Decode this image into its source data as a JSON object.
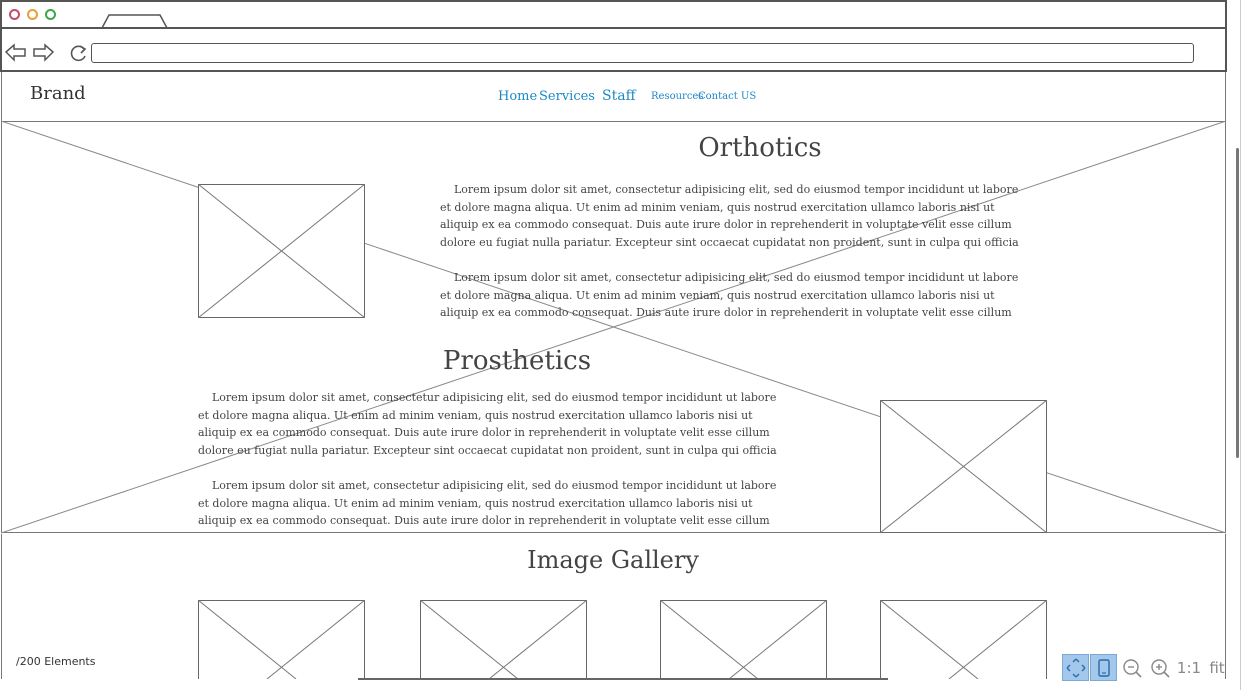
{
  "site": {
    "brand": "Brand",
    "nav": [
      "Home",
      "Services",
      "Staff",
      "Resources",
      "Contact US"
    ]
  },
  "sections": {
    "orthotics": {
      "title": "Orthotics",
      "paragraphs": [
        "Lorem ipsum dolor sit amet, consectetur adipisicing elit, sed do eiusmod tempor incididunt ut labore et dolore magna aliqua. Ut enim ad minim veniam, quis nostrud exercitation ullamco laboris nisi ut aliquip ex ea commodo consequat. Duis aute irure dolor in reprehenderit in voluptate velit esse cillum dolore eu fugiat nulla pariatur. Excepteur sint occaecat cupidatat non proident, sunt in culpa qui officia deserunt mollit anim id est laborum.",
        "Lorem ipsum dolor sit amet, consectetur adipisicing elit, sed do eiusmod tempor incididunt ut labore et dolore magna aliqua. Ut enim ad minim veniam, quis nostrud exercitation ullamco laboris nisi ut aliquip ex ea commodo consequat. Duis aute irure dolor in reprehenderit in voluptate velit esse cillum dolore eu fugiat nulla pariatur. Excepteur sint occaecat cupidatat non proident, sunt in"
      ]
    },
    "prosthetics": {
      "title": "Prosthetics",
      "paragraphs": [
        "Lorem ipsum dolor sit amet, consectetur adipisicing elit, sed do eiusmod tempor incididunt ut labore et dolore magna aliqua. Ut enim ad minim veniam, quis nostrud exercitation ullamco laboris nisi ut aliquip ex ea commodo consequat. Duis aute irure dolor in reprehenderit in voluptate velit esse cillum dolore eu fugiat nulla pariatur. Excepteur sint occaecat cupidatat non proident, sunt in culpa qui officia deserunt mollit anim id est laborum.",
        "Lorem ipsum dolor sit amet, consectetur adipisicing elit, sed do eiusmod tempor incididunt ut labore et dolore magna aliqua. Ut enim ad minim veniam, quis nostrud exercitation ullamco laboris nisi ut aliquip ex ea commodo consequat. Duis aute irure dolor in reprehenderit in voluptate velit esse cillum dolore eu fugiat nulla pariatur. Excepteur sint occaecat cupidatat non proident, sunt in"
      ]
    },
    "gallery": {
      "title": "Image Gallery"
    }
  },
  "status": {
    "elements": "/200 Elements"
  },
  "zoom": {
    "one_to_one": "1:1",
    "fit": "fit"
  },
  "colors": {
    "nav": "#1e88c7",
    "active_toggle": "#a3c8ec",
    "outline": "#555555"
  },
  "icons": [
    "back-arrow-icon",
    "forward-arrow-icon",
    "reload-icon",
    "expand-icon",
    "device-icon",
    "zoom-out-icon",
    "zoom-in-icon"
  ]
}
